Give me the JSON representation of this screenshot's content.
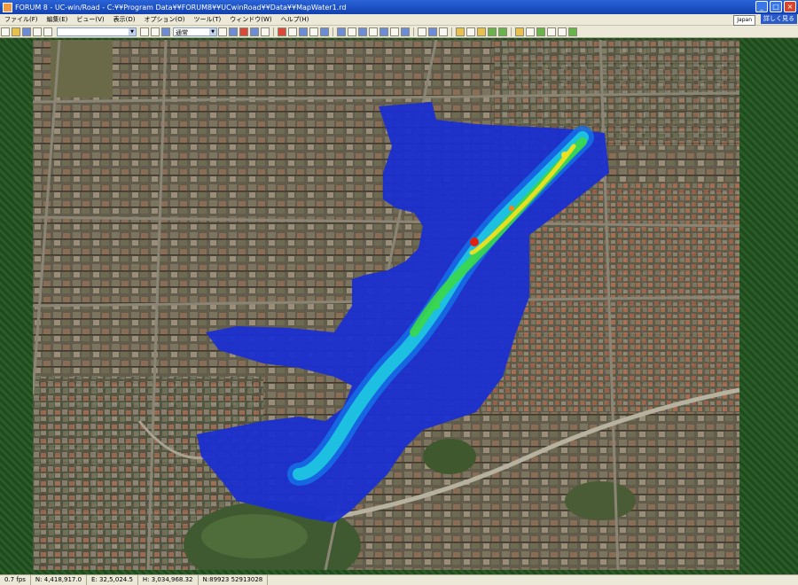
{
  "titlebar": {
    "title": "FORUM 8 - UC-win/Road - C:¥¥Program Data¥¥FORUM8¥¥UCwinRoad¥¥Data¥¥MapWater1.rd",
    "minimize": "_",
    "maximize": "□",
    "close": "×"
  },
  "menubar": {
    "items": [
      "ファイル(F)",
      "編集(E)",
      "ビュー(V)",
      "表示(D)",
      "オプション(O)",
      "ツール(T)",
      "ウィンドウ(W)",
      "ヘルプ(H)"
    ],
    "language": "Japan",
    "help_link": "詳しく見る"
  },
  "toolbar": {
    "combo1_value": "",
    "combo2_value": "通常"
  },
  "map": {
    "description_icon": "map-canvas"
  },
  "statusbar": {
    "left": "0.7 fps",
    "coord1": "N: 4,418,917.0",
    "coord2": "E: 32,5,024.5",
    "coord3": "H: 3,034,968.32",
    "coord4": "N:89923 52913028"
  },
  "colors": {
    "titlebar": "#2a64d8",
    "flood_low": "#1a2fd0",
    "flood_mid": "#1fd0e0",
    "flood_high": "#f0e020",
    "flood_peak": "#e02010"
  }
}
